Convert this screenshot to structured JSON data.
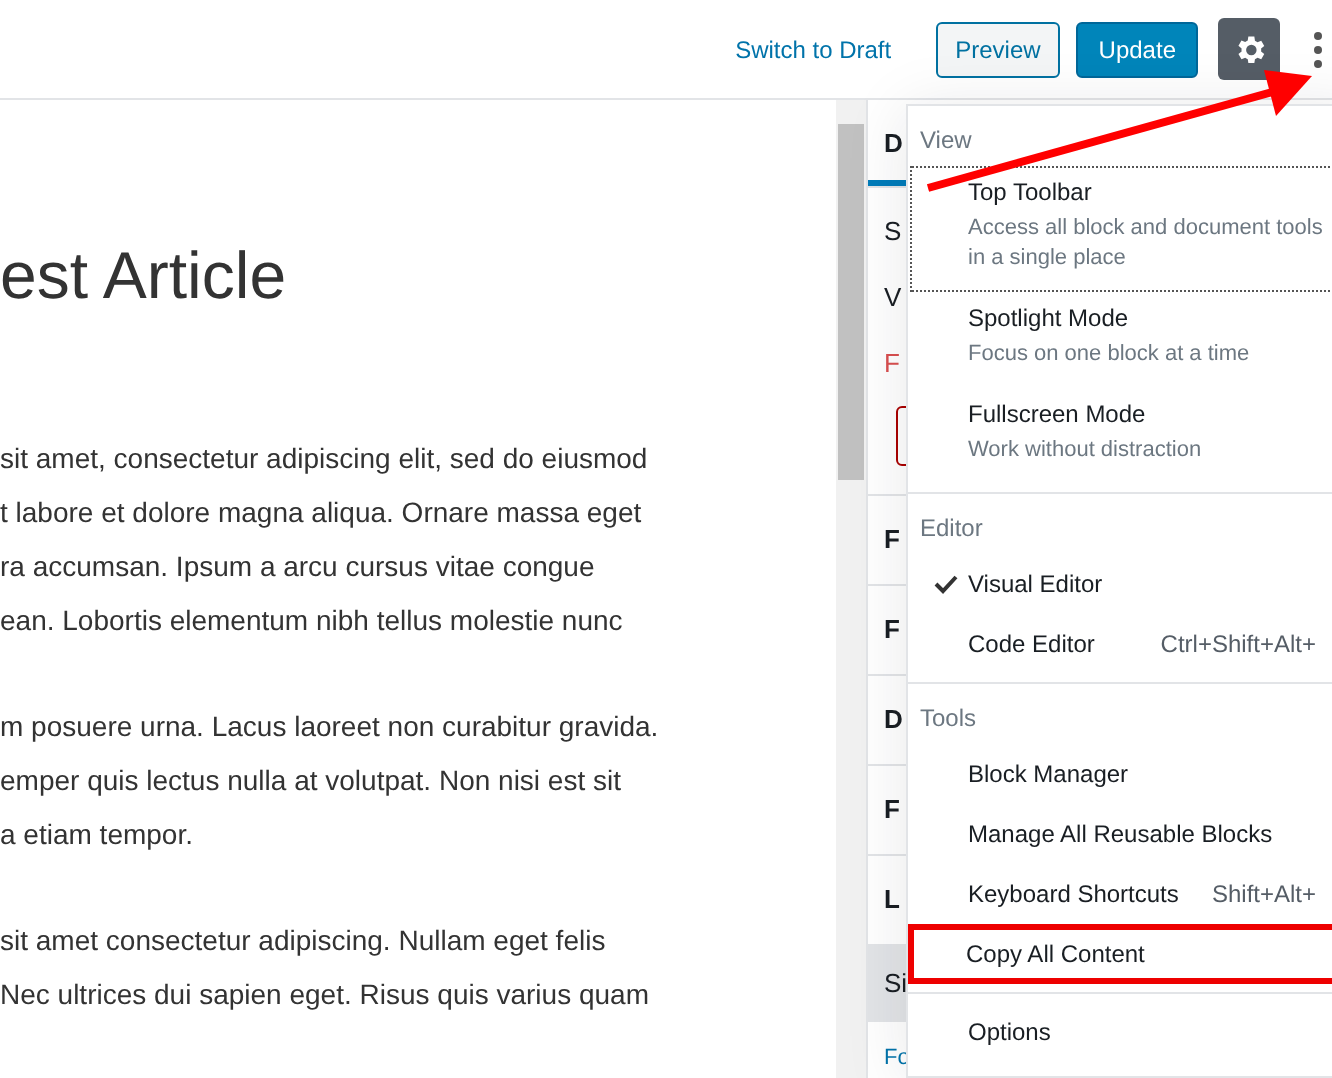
{
  "topbar": {
    "switch_link": "Switch to Draft",
    "preview_button": "Preview",
    "update_button": "Update",
    "settings_selected": true
  },
  "editor": {
    "title": "est Article",
    "paragraphs": [
      [
        "sit amet, consectetur adipiscing elit, sed do eiusmod",
        "t labore et dolore magna aliqua. Ornare massa eget",
        "ra accumsan. Ipsum a arcu cursus vitae congue",
        "ean. Lobortis elementum nibh tellus molestie nunc"
      ],
      [
        "m posuere urna. Lacus laoreet non curabitur gravida.",
        "emper quis lectus nulla at volutpat. Non nisi est sit",
        "a etiam tempor."
      ],
      [
        "sit amet consectetur adipiscing. Nullam eget felis",
        "Nec ultrices dui sapien eget. Risus quis varius quam"
      ]
    ]
  },
  "sidebar": {
    "tab": {
      "label": "D",
      "selected": true
    },
    "items": [
      {
        "kind": "text",
        "label": "S"
      },
      {
        "kind": "text",
        "label": "V"
      },
      {
        "kind": "warning",
        "label": "F"
      },
      {
        "kind": "field"
      },
      {
        "kind": "panel",
        "label": "F"
      },
      {
        "kind": "panel",
        "label": "F"
      },
      {
        "kind": "panel",
        "label": "D"
      },
      {
        "kind": "panel",
        "label": "F"
      },
      {
        "kind": "panel",
        "label": "L"
      },
      {
        "kind": "active",
        "label": "Si"
      },
      {
        "kind": "link",
        "label": "Fo"
      }
    ]
  },
  "menu": {
    "sections": [
      {
        "label": "View",
        "items": [
          {
            "label": "Top Toolbar",
            "description": "Access all block and document tools in a single place",
            "focused": true,
            "checked": false
          },
          {
            "label": "Spotlight Mode",
            "description": "Focus on one block at a time",
            "focused": false,
            "checked": false
          },
          {
            "label": "Fullscreen Mode",
            "description": "Work without distraction",
            "focused": false,
            "checked": false
          }
        ]
      },
      {
        "label": "Editor",
        "items": [
          {
            "label": "Visual Editor",
            "focused": false,
            "checked": true
          },
          {
            "label": "Code Editor",
            "shortcut": "Ctrl+Shift+Alt+",
            "focused": false,
            "checked": false
          }
        ]
      },
      {
        "label": "Tools",
        "items": [
          {
            "label": "Block Manager",
            "focused": false,
            "checked": false
          },
          {
            "label": "Manage All Reusable Blocks",
            "focused": false,
            "checked": false
          },
          {
            "label": "Keyboard Shortcuts",
            "shortcut": "Shift+Alt+",
            "focused": false,
            "checked": false
          },
          {
            "label": "Copy All Content",
            "focused": false,
            "checked": false,
            "highlighted": true
          }
        ]
      },
      {
        "items": [
          {
            "label": "Options",
            "focused": false,
            "checked": false
          }
        ]
      }
    ]
  },
  "annotation": {
    "arrow": true
  }
}
